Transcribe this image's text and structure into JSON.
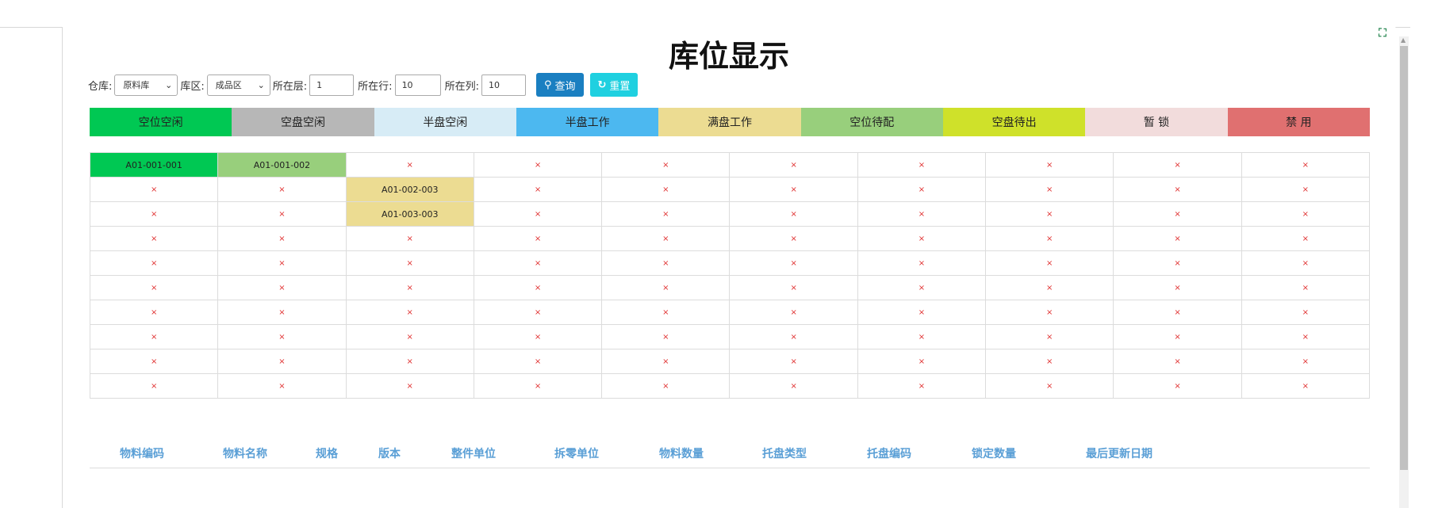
{
  "title": "库位显示",
  "filters": {
    "warehouse_label": "仓库:",
    "warehouse_value": "原料库",
    "area_label": "库区:",
    "area_value": "成品区",
    "floor_label": "所在层:",
    "floor_value": "1",
    "row_label": "所在行:",
    "row_value": "10",
    "col_label": "所在列:",
    "col_value": "10",
    "query_label": "查询",
    "reset_label": "重置"
  },
  "legend": [
    {
      "label": "空位空闲",
      "color": "#00c853"
    },
    {
      "label": "空盘空闲",
      "color": "#b7b7b7"
    },
    {
      "label": "半盘空闲",
      "color": "#d7ecf6"
    },
    {
      "label": "半盘工作",
      "color": "#4cb8f0"
    },
    {
      "label": "满盘工作",
      "color": "#ecdc92"
    },
    {
      "label": "空位待配",
      "color": "#98cf7c"
    },
    {
      "label": "空盘待出",
      "color": "#cfe12a"
    },
    {
      "label": "暂 锁",
      "color": "#f2dcdc"
    },
    {
      "label": "禁 用",
      "color": "#e07070"
    }
  ],
  "empty_mark": "×",
  "grid_rows": [
    [
      {
        "code": "A01-001-001",
        "color": "#00c853"
      },
      {
        "code": "A01-001-002",
        "color": "#98cf7c"
      },
      null,
      null,
      null,
      null,
      null,
      null,
      null,
      null
    ],
    [
      null,
      null,
      {
        "code": "A01-002-003",
        "color": "#ecdc92"
      },
      null,
      null,
      null,
      null,
      null,
      null,
      null
    ],
    [
      null,
      null,
      {
        "code": "A01-003-003",
        "color": "#ecdc92"
      },
      null,
      null,
      null,
      null,
      null,
      null,
      null
    ],
    [
      null,
      null,
      null,
      null,
      null,
      null,
      null,
      null,
      null,
      null
    ],
    [
      null,
      null,
      null,
      null,
      null,
      null,
      null,
      null,
      null,
      null
    ],
    [
      null,
      null,
      null,
      null,
      null,
      null,
      null,
      null,
      null,
      null
    ],
    [
      null,
      null,
      null,
      null,
      null,
      null,
      null,
      null,
      null,
      null
    ],
    [
      null,
      null,
      null,
      null,
      null,
      null,
      null,
      null,
      null,
      null
    ],
    [
      null,
      null,
      null,
      null,
      null,
      null,
      null,
      null,
      null,
      null
    ],
    [
      null,
      null,
      null,
      null,
      null,
      null,
      null,
      null,
      null,
      null
    ]
  ],
  "info_headers": [
    "物料编码",
    "物料名称",
    "规格",
    "版本",
    "整件单位",
    "拆零单位",
    "物料数量",
    "托盘类型",
    "托盘编码",
    "锁定数量",
    "最后更新日期"
  ],
  "icons": {
    "expand": "expand-icon",
    "search": "search-icon",
    "refresh": "refresh-icon",
    "chevron": "chevron-down-icon"
  }
}
